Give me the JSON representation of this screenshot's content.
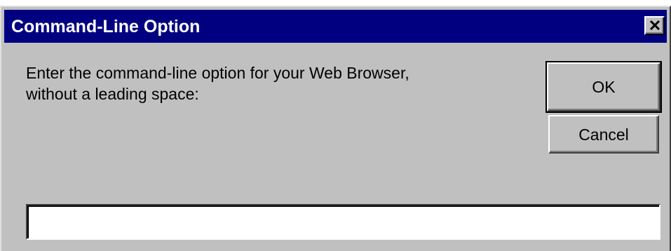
{
  "window": {
    "title": "Command-Line Option",
    "close_glyph": "✕"
  },
  "message": {
    "line1": "Enter the command-line option for your Web Browser,",
    "line2": "without a leading space:"
  },
  "buttons": {
    "ok_label": "OK",
    "cancel_label": "Cancel"
  },
  "input": {
    "value": "",
    "placeholder": ""
  },
  "colors": {
    "title_bar": "#000080",
    "dialog_face": "#c0c0c0",
    "title_text": "#ffffff"
  },
  "icons": {
    "close": "close-icon"
  }
}
